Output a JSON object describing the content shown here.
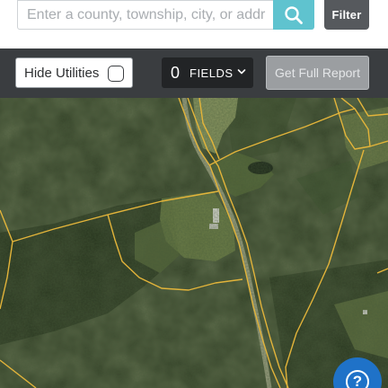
{
  "search": {
    "placeholder": "Enter a county, township, city, or address",
    "search_icon": "search-icon"
  },
  "filter": {
    "label": "Filter"
  },
  "toolbar": {
    "hide_utilities_label": "Hide Utilities",
    "hide_utilities_checked": false,
    "fields_count": "0",
    "fields_label": "FIELDS",
    "fields_icon": "chevron-down-icon",
    "report_label": "Get Full Report",
    "report_enabled": false
  },
  "map": {
    "view": "satellite",
    "parcel_line_color": "#e3b43a"
  },
  "help": {
    "symbol": "?",
    "icon": "help-icon"
  },
  "colors": {
    "search_button": "#5fc3cf",
    "filter_button": "#56595d",
    "toolbar_bg": "#3a3d40",
    "help_button": "#1f72c8"
  }
}
